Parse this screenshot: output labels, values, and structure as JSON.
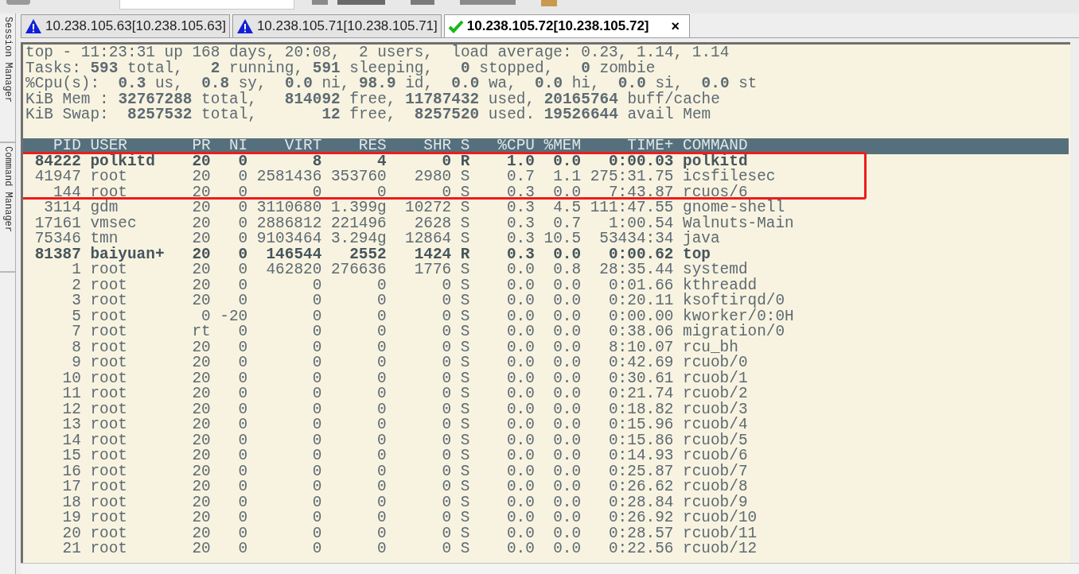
{
  "side_panels": [
    {
      "label": "Session Manager"
    },
    {
      "label": "Command Manager"
    }
  ],
  "tabs": [
    {
      "label": "10.238.105.63[10.238.105.63]",
      "kind": "warning",
      "selected": false
    },
    {
      "label": "10.238.105.71[10.238.105.71]",
      "kind": "warning",
      "selected": false
    },
    {
      "label": "10.238.105.72[10.238.105.72]",
      "kind": "connected",
      "selected": true,
      "close": "×"
    }
  ],
  "summary": [
    "top - 11:23:31 up 168 days, 20:08,  2 users,  load average: 0.23, 1.14, 1.14",
    "Tasks: **593** total,   **2** running, **591** sleeping,   **0** stopped,   **0** zombie",
    "%Cpu(s):  **0.3** us,  **0.8** sy,  **0.0** ni, **98.9** id,  **0.0** wa,  **0.0** hi,  **0.0** si,  **0.0** st",
    "KiB Mem : **32767288** total,   **814092** free, **11787432** used, **20165764** buff/cache",
    "KiB Swap:  **8257532** total,       **12** free,  **8257520** used. **19526644** avail Mem"
  ],
  "columns": [
    "PID",
    "USER",
    "PR",
    "NI",
    "VIRT",
    "RES",
    "SHR",
    "S",
    "%CPU",
    "%MEM",
    "TIME+",
    "COMMAND"
  ],
  "rows": [
    {
      "cells": [
        "84222",
        "polkitd",
        "20",
        "0",
        "8",
        "4",
        "0",
        "R",
        "1.0",
        "0.0",
        "0:00.03",
        "polkitd"
      ],
      "bold": true,
      "boxed": true
    },
    {
      "cells": [
        "41947",
        "root",
        "20",
        "0",
        "2581436",
        "353760",
        "2980",
        "S",
        "0.7",
        "1.1",
        "275:31.75",
        "icsfilesec"
      ],
      "bold": false,
      "boxed": true
    },
    {
      "cells": [
        "144",
        "root",
        "20",
        "0",
        "0",
        "0",
        "0",
        "S",
        "0.3",
        "0.0",
        "7:43.87",
        "rcuos/6"
      ],
      "bold": false,
      "boxed": true
    },
    {
      "cells": [
        "3114",
        "gdm",
        "20",
        "0",
        "3110680",
        "1.399g",
        "10272",
        "S",
        "0.3",
        "4.5",
        "111:47.55",
        "gnome-shell"
      ],
      "bold": false,
      "boxed": false
    },
    {
      "cells": [
        "17161",
        "vmsec",
        "20",
        "0",
        "2886812",
        "221496",
        "2628",
        "S",
        "0.3",
        "0.7",
        "1:00.54",
        "Walnuts-Main"
      ],
      "bold": false,
      "boxed": false
    },
    {
      "cells": [
        "75346",
        "tmn",
        "20",
        "0",
        "9103464",
        "3.294g",
        "12864",
        "S",
        "0.3",
        "10.5",
        "53434:34",
        "java"
      ],
      "bold": false,
      "boxed": false
    },
    {
      "cells": [
        "81387",
        "baiyuan+",
        "20",
        "0",
        "146544",
        "2552",
        "1424",
        "R",
        "0.3",
        "0.0",
        "0:00.62",
        "top"
      ],
      "bold": true,
      "boxed": false
    },
    {
      "cells": [
        "1",
        "root",
        "20",
        "0",
        "462820",
        "276636",
        "1776",
        "S",
        "0.0",
        "0.8",
        "28:35.44",
        "systemd"
      ],
      "bold": false,
      "boxed": false
    },
    {
      "cells": [
        "2",
        "root",
        "20",
        "0",
        "0",
        "0",
        "0",
        "S",
        "0.0",
        "0.0",
        "0:01.66",
        "kthreadd"
      ],
      "bold": false,
      "boxed": false
    },
    {
      "cells": [
        "3",
        "root",
        "20",
        "0",
        "0",
        "0",
        "0",
        "S",
        "0.0",
        "0.0",
        "0:20.11",
        "ksoftirqd/0"
      ],
      "bold": false,
      "boxed": false
    },
    {
      "cells": [
        "5",
        "root",
        "0",
        "-20",
        "0",
        "0",
        "0",
        "S",
        "0.0",
        "0.0",
        "0:00.00",
        "kworker/0:0H"
      ],
      "bold": false,
      "boxed": false
    },
    {
      "cells": [
        "7",
        "root",
        "rt",
        "0",
        "0",
        "0",
        "0",
        "S",
        "0.0",
        "0.0",
        "0:38.06",
        "migration/0"
      ],
      "bold": false,
      "boxed": false
    },
    {
      "cells": [
        "8",
        "root",
        "20",
        "0",
        "0",
        "0",
        "0",
        "S",
        "0.0",
        "0.0",
        "8:10.07",
        "rcu_bh"
      ],
      "bold": false,
      "boxed": false
    },
    {
      "cells": [
        "9",
        "root",
        "20",
        "0",
        "0",
        "0",
        "0",
        "S",
        "0.0",
        "0.0",
        "0:42.69",
        "rcuob/0"
      ],
      "bold": false,
      "boxed": false
    },
    {
      "cells": [
        "10",
        "root",
        "20",
        "0",
        "0",
        "0",
        "0",
        "S",
        "0.0",
        "0.0",
        "0:30.61",
        "rcuob/1"
      ],
      "bold": false,
      "boxed": false
    },
    {
      "cells": [
        "11",
        "root",
        "20",
        "0",
        "0",
        "0",
        "0",
        "S",
        "0.0",
        "0.0",
        "0:21.74",
        "rcuob/2"
      ],
      "bold": false,
      "boxed": false
    },
    {
      "cells": [
        "12",
        "root",
        "20",
        "0",
        "0",
        "0",
        "0",
        "S",
        "0.0",
        "0.0",
        "0:18.82",
        "rcuob/3"
      ],
      "bold": false,
      "boxed": false
    },
    {
      "cells": [
        "13",
        "root",
        "20",
        "0",
        "0",
        "0",
        "0",
        "S",
        "0.0",
        "0.0",
        "0:15.96",
        "rcuob/4"
      ],
      "bold": false,
      "boxed": false
    },
    {
      "cells": [
        "14",
        "root",
        "20",
        "0",
        "0",
        "0",
        "0",
        "S",
        "0.0",
        "0.0",
        "0:15.86",
        "rcuob/5"
      ],
      "bold": false,
      "boxed": false
    },
    {
      "cells": [
        "15",
        "root",
        "20",
        "0",
        "0",
        "0",
        "0",
        "S",
        "0.0",
        "0.0",
        "0:14.93",
        "rcuob/6"
      ],
      "bold": false,
      "boxed": false
    },
    {
      "cells": [
        "16",
        "root",
        "20",
        "0",
        "0",
        "0",
        "0",
        "S",
        "0.0",
        "0.0",
        "0:25.87",
        "rcuob/7"
      ],
      "bold": false,
      "boxed": false
    },
    {
      "cells": [
        "17",
        "root",
        "20",
        "0",
        "0",
        "0",
        "0",
        "S",
        "0.0",
        "0.0",
        "0:26.62",
        "rcuob/8"
      ],
      "bold": false,
      "boxed": false
    },
    {
      "cells": [
        "18",
        "root",
        "20",
        "0",
        "0",
        "0",
        "0",
        "S",
        "0.0",
        "0.0",
        "0:28.84",
        "rcuob/9"
      ],
      "bold": false,
      "boxed": false
    },
    {
      "cells": [
        "19",
        "root",
        "20",
        "0",
        "0",
        "0",
        "0",
        "S",
        "0.0",
        "0.0",
        "0:26.92",
        "rcuob/10"
      ],
      "bold": false,
      "boxed": false
    },
    {
      "cells": [
        "20",
        "root",
        "20",
        "0",
        "0",
        "0",
        "0",
        "S",
        "0.0",
        "0.0",
        "0:28.57",
        "rcuob/11"
      ],
      "bold": false,
      "boxed": false
    },
    {
      "cells": [
        "21",
        "root",
        "20",
        "0",
        "0",
        "0",
        "0",
        "S",
        "0.0",
        "0.0",
        "0:22.56",
        "rcuob/12"
      ],
      "bold": false,
      "boxed": false
    }
  ]
}
